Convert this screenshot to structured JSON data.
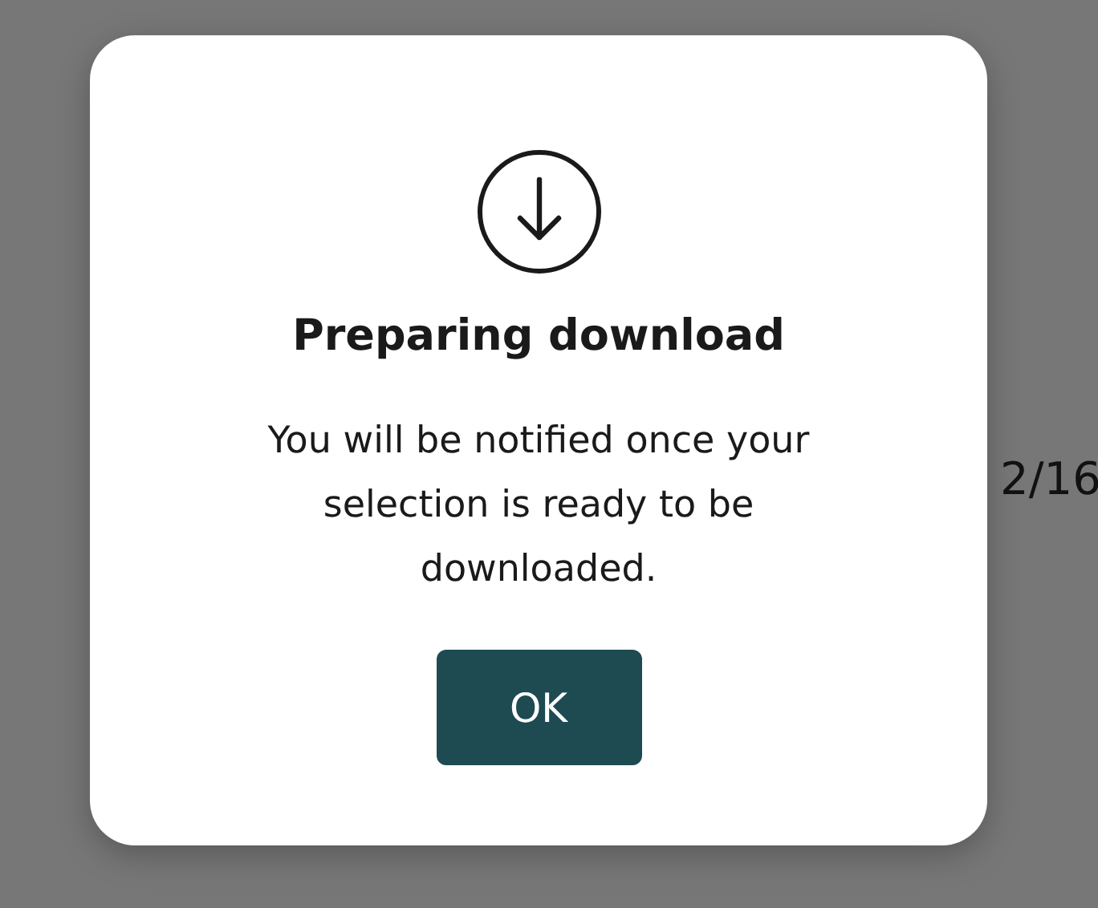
{
  "dialog": {
    "title": "Preparing download",
    "message": "You will be notified once your selection is ready to be downloaded.",
    "button": "OK"
  },
  "background": {
    "page_counter": "2/16"
  }
}
